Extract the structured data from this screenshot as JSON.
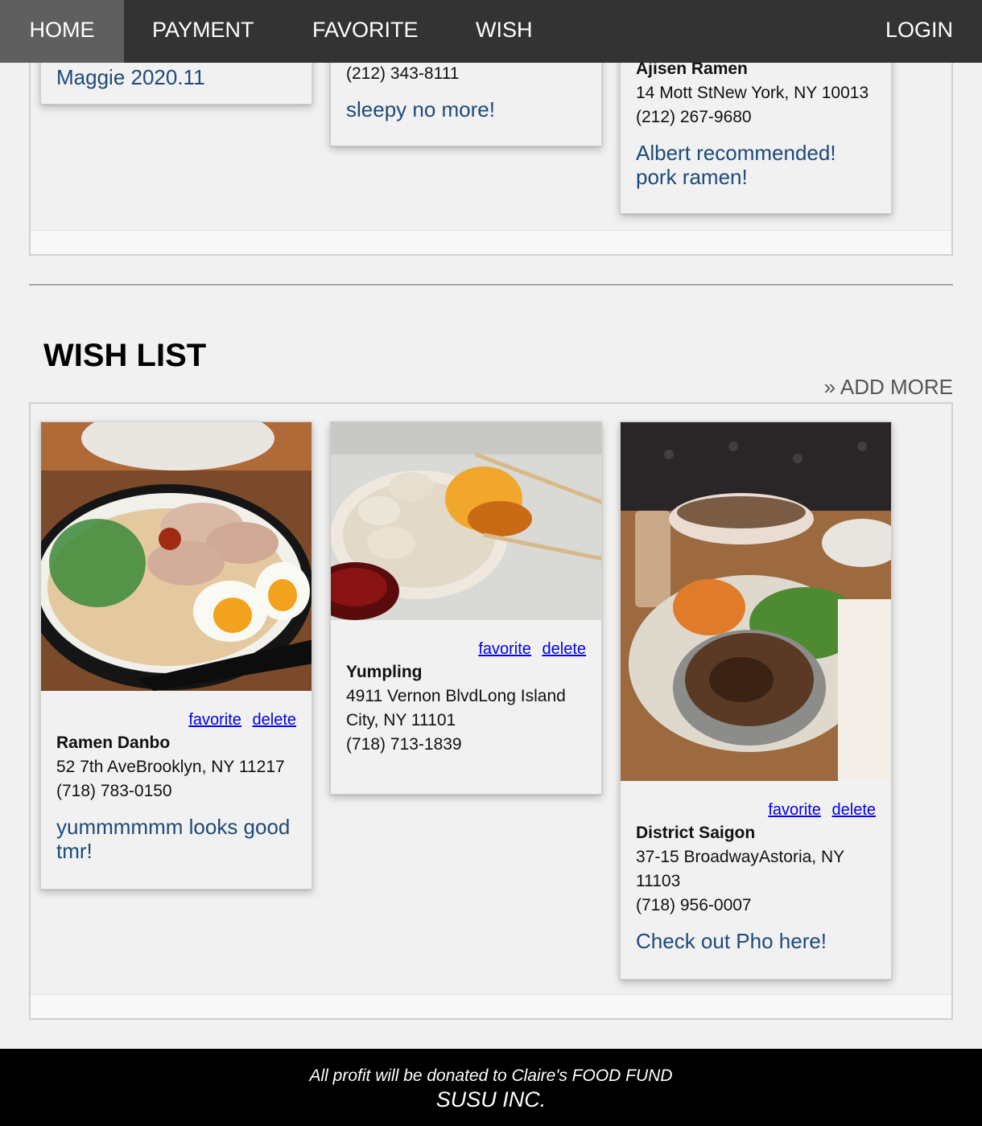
{
  "nav": {
    "home": "HOME",
    "payment": "PAYMENT",
    "favorite": "FAVORITE",
    "wish": "WISH",
    "login": "LOGIN"
  },
  "favorites_section": {
    "cards": [
      {
        "note": "Maggie 2020.11"
      },
      {
        "phone": "(212) 343-8111",
        "note": "sleepy no more!"
      },
      {
        "name": "Ajisen Ramen",
        "address": "14 Mott StNew York, NY 10013",
        "phone": "(212) 267-9680",
        "note": "Albert recommended! pork ramen!"
      }
    ]
  },
  "wish_section": {
    "title": "WISH LIST",
    "add_more": "» ADD MORE",
    "cards": [
      {
        "image": "ramen bowl photo",
        "favorite": "favorite",
        "delete": "delete",
        "name": "Ramen Danbo",
        "address": "52 7th AveBrooklyn, NY 11217",
        "phone": "(718) 783-0150",
        "note": "yummmmmm looks good tmr!"
      },
      {
        "image": "dumplings photo",
        "favorite": "favorite",
        "delete": "delete",
        "name": "Yumpling",
        "address": "4911 Vernon BlvdLong Island City, NY 11101",
        "phone": "(718) 713-1839",
        "note": ""
      },
      {
        "image": "vietnamese dishes photo",
        "favorite": "favorite",
        "delete": "delete",
        "name": "District Saigon",
        "address": "37-15 BroadwayAstoria, NY 11103",
        "phone": "(718) 956-0007",
        "note": "Check out Pho here!"
      }
    ]
  },
  "footer": {
    "line1": "All profit will be donated to Claire's FOOD FUND",
    "line2": "SUSU INC."
  }
}
